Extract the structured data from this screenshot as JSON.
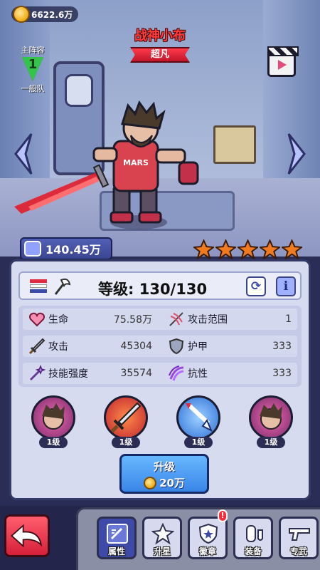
{
  "currency": {
    "amount": "6622.6万",
    "icon": "gold-coin-icon"
  },
  "lineup": {
    "title": "主阵容",
    "number": "1",
    "team": "一般队"
  },
  "hero": {
    "name": "战神小布",
    "rarity": "超凡",
    "shirt_text": "MARS"
  },
  "power": {
    "value": "140.45万"
  },
  "stars": {
    "count": 5,
    "max": 5,
    "color": "#f07a1e"
  },
  "panel": {
    "level_label": "等级:",
    "level_value": "130/130",
    "stats": [
      {
        "icon": "heart-icon",
        "label": "生命",
        "value": "75.58万"
      },
      {
        "icon": "range-icon",
        "label": "攻击范围",
        "value": "1"
      },
      {
        "icon": "sword-icon",
        "label": "攻击",
        "value": "45304"
      },
      {
        "icon": "armor-icon",
        "label": "护甲",
        "value": "333"
      },
      {
        "icon": "magic-wand-icon",
        "label": "技能强度",
        "value": "35574"
      },
      {
        "icon": "resist-icon",
        "label": "抗性",
        "value": "333"
      }
    ],
    "skills": [
      {
        "icon": "hero-portrait-skill-icon",
        "level": "1级"
      },
      {
        "icon": "sword-skill-icon",
        "level": "1级"
      },
      {
        "icon": "arrow-down-skill-icon",
        "level": "1级"
      },
      {
        "icon": "hero-portrait-skill-icon",
        "level": "1级"
      }
    ],
    "upgrade": {
      "label": "升级",
      "cost": "20万"
    }
  },
  "tabs": [
    {
      "icon": "attributes-icon",
      "label": "属性",
      "active": true
    },
    {
      "icon": "star-up-icon",
      "label": "升星"
    },
    {
      "icon": "medal-icon",
      "label": "徽章",
      "badge": "!"
    },
    {
      "icon": "equipment-icon",
      "label": "装备"
    },
    {
      "icon": "exclusive-weapon-icon",
      "label": "专武"
    }
  ],
  "colors": {
    "accent": "#3e4aa7",
    "danger": "#e02a3e",
    "panel": "#d6dbf0",
    "name": "#ff3a3a"
  }
}
